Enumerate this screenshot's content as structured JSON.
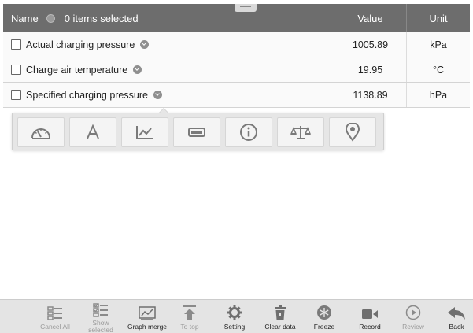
{
  "header": {
    "name_label": "Name",
    "selection_status": "0 items selected",
    "value_label": "Value",
    "unit_label": "Unit"
  },
  "rows": [
    {
      "name": "Actual charging pressure",
      "value": "1005.89",
      "unit": "kPa",
      "checked": false
    },
    {
      "name": "Charge air temperature",
      "value": "19.95",
      "unit": "°C",
      "checked": false
    },
    {
      "name": "Specified charging pressure",
      "value": "1138.89",
      "unit": "hPa",
      "checked": false
    }
  ],
  "popup_toolbar": {
    "buttons": [
      {
        "icon": "gauge-icon"
      },
      {
        "icon": "text-view-icon"
      },
      {
        "icon": "line-graph-icon"
      },
      {
        "icon": "digital-display-icon"
      },
      {
        "icon": "info-icon"
      },
      {
        "icon": "balance-scale-icon"
      },
      {
        "icon": "location-pin-icon"
      }
    ]
  },
  "bottom_toolbar": {
    "items": [
      {
        "label": "Cancel All",
        "icon": "cancel-all-icon",
        "enabled": false
      },
      {
        "label": "Show selected",
        "icon": "show-selected-icon",
        "enabled": false
      },
      {
        "label": "Graph merge",
        "icon": "graph-merge-icon",
        "enabled": true
      },
      {
        "label": "To top",
        "icon": "to-top-icon",
        "enabled": false
      },
      {
        "label": "Setting",
        "icon": "setting-icon",
        "enabled": true
      },
      {
        "label": "Clear data",
        "icon": "trash-icon",
        "enabled": true
      },
      {
        "label": "Freeze",
        "icon": "freeze-icon",
        "enabled": true
      },
      {
        "label": "Record",
        "icon": "record-icon",
        "enabled": true
      },
      {
        "label": "Review",
        "icon": "review-icon",
        "enabled": false
      },
      {
        "label": "Back",
        "icon": "back-arrow-icon",
        "enabled": true
      }
    ]
  },
  "colors": {
    "header_bg": "#6d6d6d",
    "toolbar_bg": "#e4e4e4",
    "icon_gray": "#8a8a8a"
  }
}
